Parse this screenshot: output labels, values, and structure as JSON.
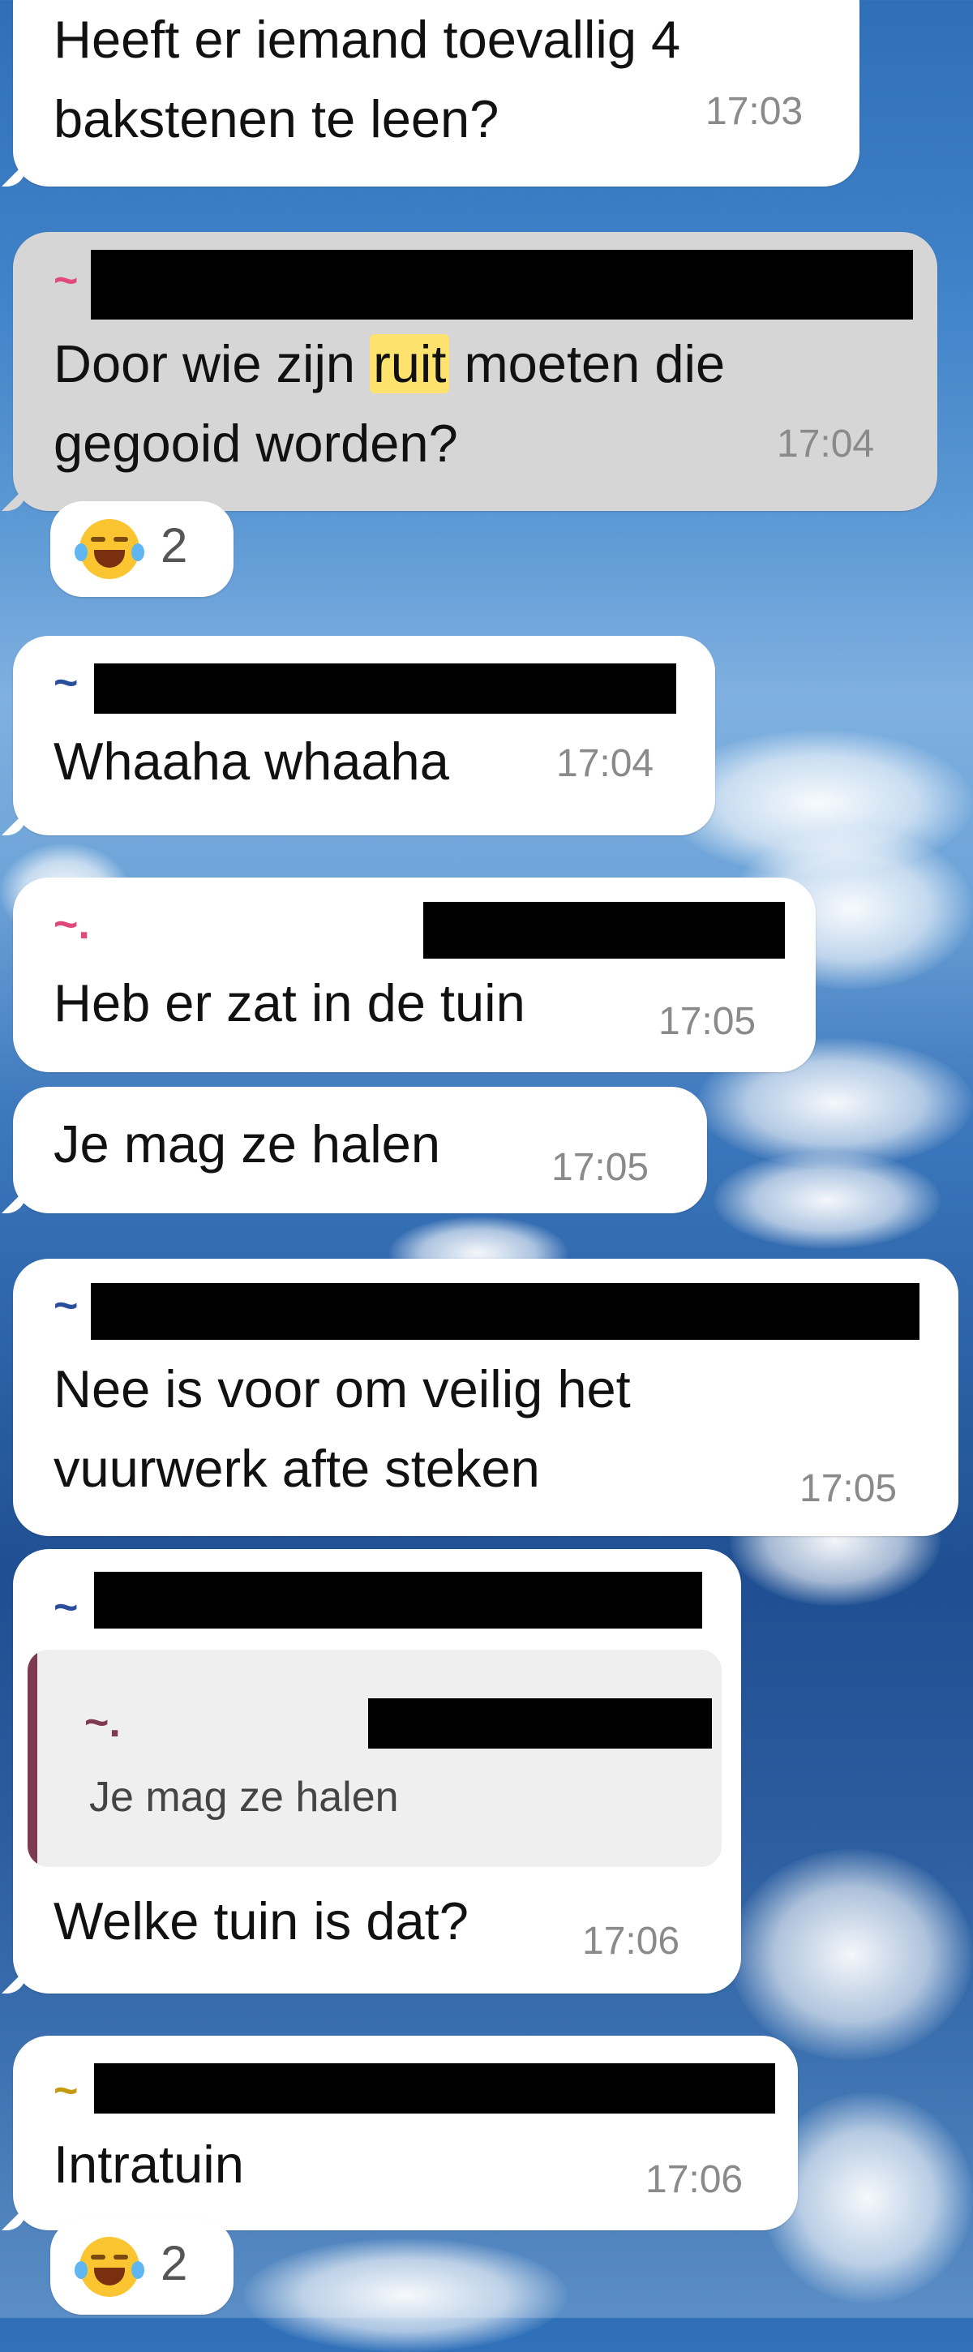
{
  "colors": {
    "sender_name_pink": "#e04a7a",
    "sender_name_blue": "#2a4f9a",
    "sender_name_yellow": "#c49a10",
    "highlight": "#fde26d",
    "quote_bar": "#7e3a50"
  },
  "messages": [
    {
      "text": "Heeft er iemand toevallig 4\nbakstenen te leen?",
      "time": "17:03"
    },
    {
      "sender_tilde": "~",
      "text_before": "Door wie zijn ",
      "text_highlight": "ruit",
      "text_after": " moeten die\ngegooid worden?",
      "time": "17:04",
      "reaction": {
        "emoji": "face-with-tears-of-joy",
        "count": "2"
      }
    },
    {
      "sender_tilde": "~",
      "text": "Whaaha whaaha",
      "time": "17:04"
    },
    {
      "sender_tilde": "~.",
      "text": "Heb er zat in de tuin",
      "time": "17:05"
    },
    {
      "text": "Je mag ze halen",
      "time": "17:05"
    },
    {
      "sender_tilde": "~",
      "text": "Nee is voor om veilig het\nvuurwerk afte steken",
      "time": "17:05"
    },
    {
      "sender_tilde": "~",
      "quote": {
        "sender_tilde": "~.",
        "text": "Je mag ze halen"
      },
      "text": "Welke tuin is dat?",
      "time": "17:06"
    },
    {
      "sender_tilde": "~",
      "text": "Intratuin",
      "time": "17:06",
      "reaction": {
        "emoji": "face-with-tears-of-joy",
        "count": "2"
      }
    }
  ]
}
